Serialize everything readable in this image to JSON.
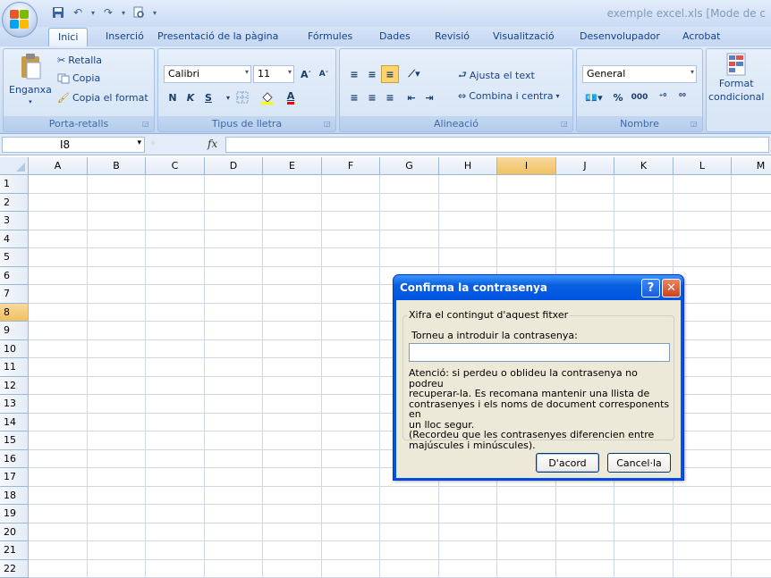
{
  "window": {
    "title": "exemple excel.xls  [Mode de c"
  },
  "tabs": [
    "Inici",
    "Inserció",
    "Presentació de la pàgina",
    "Fórmules",
    "Dades",
    "Revisió",
    "Visualització",
    "Desenvolupador",
    "Acrobat"
  ],
  "ribbon": {
    "clipboard": {
      "label": "Porta-retalls",
      "paste": "Enganxa",
      "cut": "Retalla",
      "copy": "Copia",
      "format_painter": "Copia el format"
    },
    "font": {
      "label": "Tipus de lletra",
      "font_name": "Calibri",
      "font_size": "11",
      "bold": "N",
      "italic": "K",
      "underline": "S"
    },
    "alignment": {
      "label": "Alineació",
      "wrap_text": "Ajusta el text",
      "merge_center": "Combina i centra"
    },
    "number": {
      "label": "Nombre",
      "format": "General",
      "percent": "%",
      "thousands": "000"
    },
    "styles": {
      "conditional_format_line1": "Format",
      "conditional_format_line2": "condicional"
    }
  },
  "formula_bar": {
    "name_box": "I8",
    "fx": "fx",
    "value": ""
  },
  "grid": {
    "columns": [
      "A",
      "B",
      "C",
      "D",
      "E",
      "F",
      "G",
      "H",
      "I",
      "J",
      "K",
      "L",
      "M"
    ],
    "rows": [
      "1",
      "2",
      "3",
      "4",
      "5",
      "6",
      "7",
      "8",
      "9",
      "10",
      "11",
      "12",
      "13",
      "14",
      "15",
      "16",
      "17",
      "18",
      "19",
      "20",
      "21",
      "22"
    ],
    "selected_column": "I",
    "selected_row": "8"
  },
  "dialog": {
    "title": "Confirma la contrasenya",
    "help": "?",
    "close": "✕",
    "group_label": "Xifra el contingut d'aquest fitxer",
    "field_label": "Torneu a introduir la contrasenya:",
    "password_value": "",
    "warning_lines": [
      "Atenció: si perdeu o oblideu la contrasenya no podreu",
      "recuperar-la. Es recomana mantenir una llista de",
      "contrasenyes i els noms de document corresponents en",
      "un lloc segur.",
      "(Recordeu que les contrasenyes diferencien entre",
      "majúscules i minúscules)."
    ],
    "ok": "D'acord",
    "cancel": "Cancel·la"
  }
}
